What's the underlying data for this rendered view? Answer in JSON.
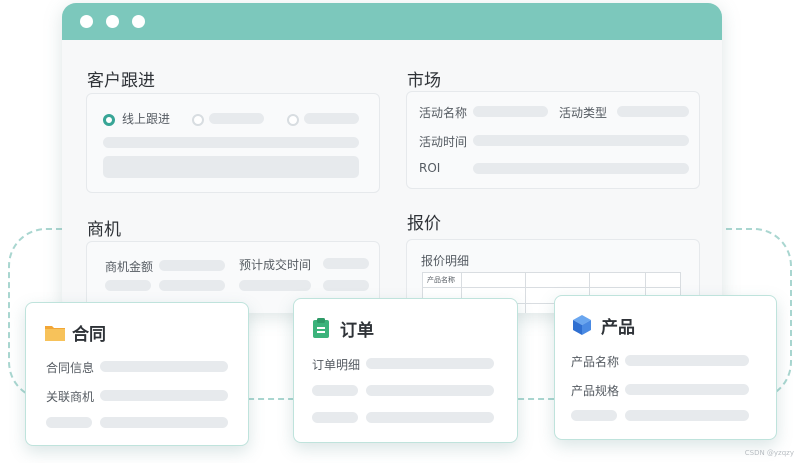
{
  "window": {
    "customer_followup": {
      "title": "客户跟进",
      "radio_selected_label": "线上跟进"
    },
    "market": {
      "title": "市场",
      "activity_name": "活动名称",
      "activity_type": "活动类型",
      "activity_time": "活动时间",
      "roi": "ROI"
    },
    "opportunity": {
      "title": "商机",
      "amount": "商机金额",
      "expected_close": "预计成交时间"
    },
    "quote": {
      "title": "报价",
      "detail": "报价明细",
      "table_header": "产品名称"
    }
  },
  "cards": {
    "contract": {
      "title": "合同",
      "info": "合同信息",
      "related": "关联商机",
      "icon": "folder-icon"
    },
    "order": {
      "title": "订单",
      "detail": "订单明细",
      "icon": "clipboard-icon"
    },
    "product": {
      "title": "产品",
      "name": "产品名称",
      "spec": "产品规格",
      "icon": "cube-icon"
    }
  },
  "watermark": "CSDN @yzqzy",
  "colors": {
    "accent": "#7cc8bc",
    "radio_on": "#38a596",
    "placeholder": "#e7eaed"
  }
}
